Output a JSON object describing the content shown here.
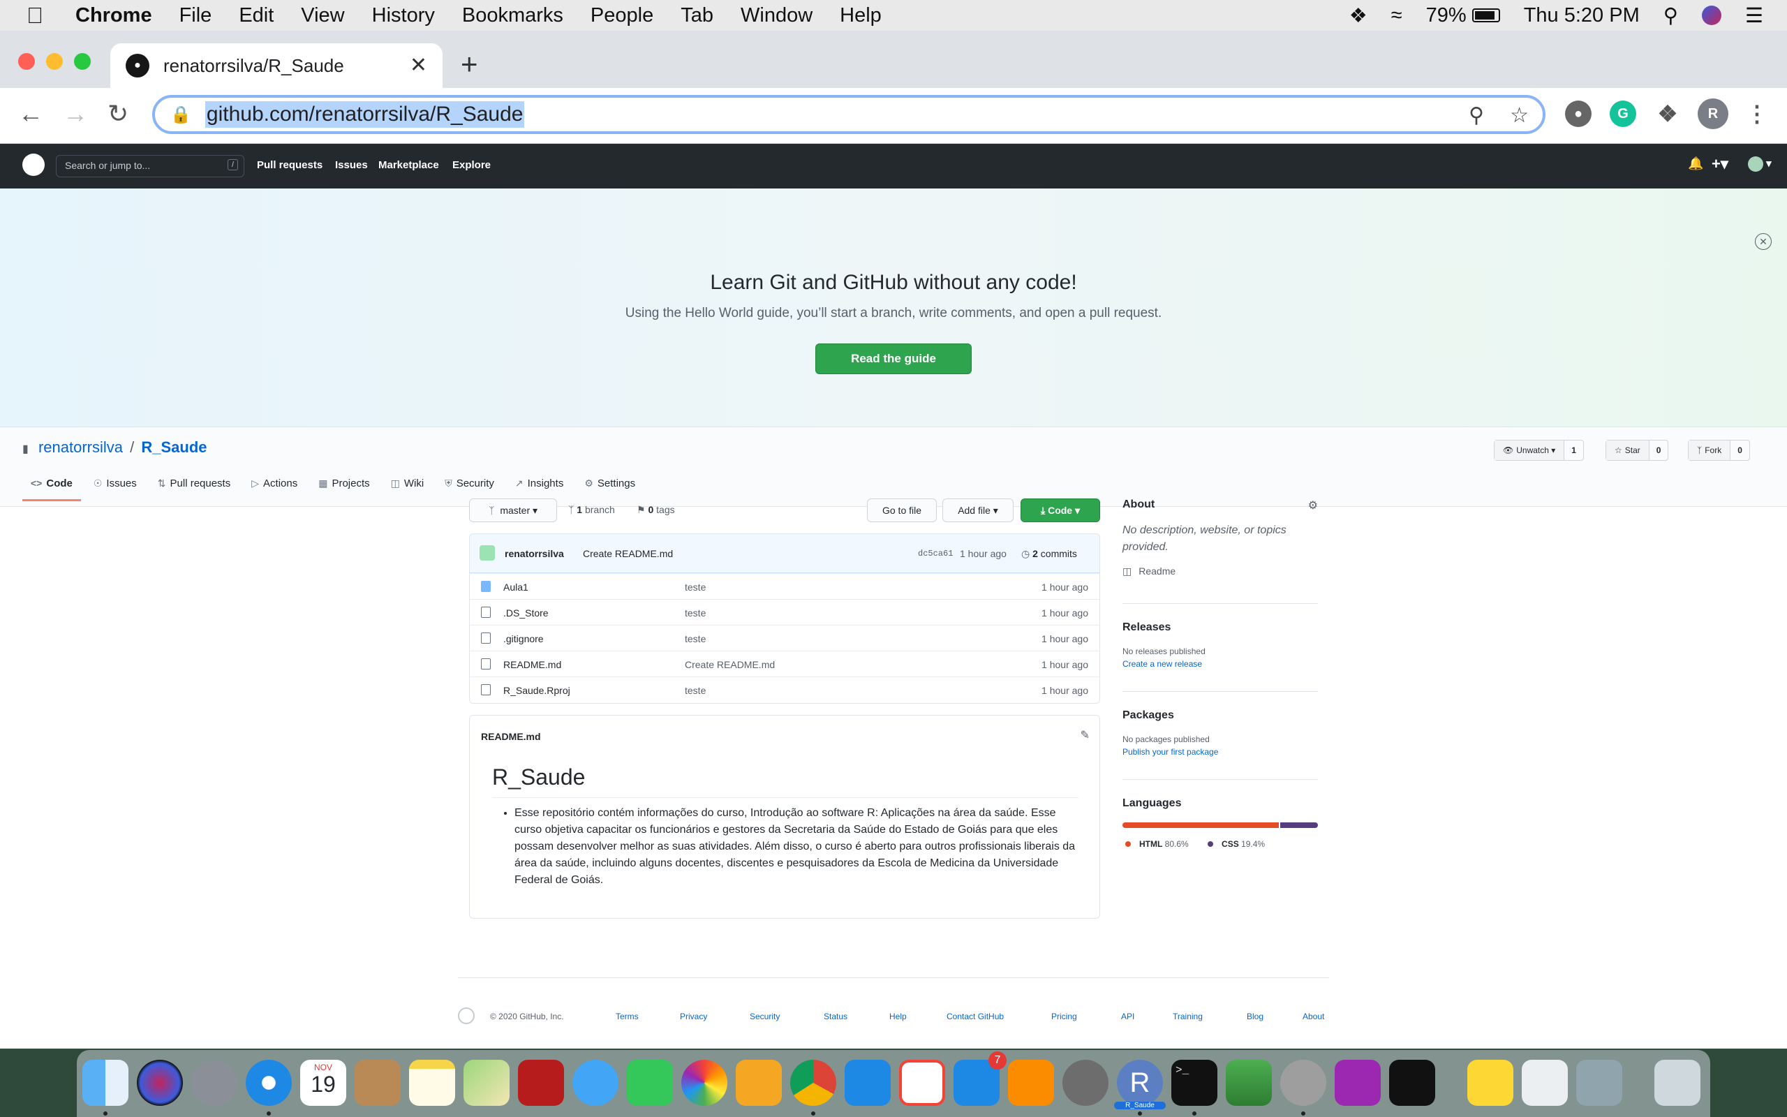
{
  "menubar": {
    "app": "Chrome",
    "items": [
      "File",
      "Edit",
      "View",
      "History",
      "Bookmarks",
      "People",
      "Tab",
      "Window",
      "Help"
    ],
    "battery": "79%",
    "clock": "Thu 5:20 PM"
  },
  "browser": {
    "tab_title": "renatorrsilva/R_Saude",
    "url": "github.com/renatorrsilva/R_Saude",
    "profile_initial": "R"
  },
  "github_header": {
    "search_placeholder": "Search or jump to...",
    "slash": "/",
    "nav": [
      "Pull requests",
      "Issues",
      "Marketplace",
      "Explore"
    ]
  },
  "banner": {
    "title": "Learn Git and GitHub without any code!",
    "subtitle": "Using the Hello World guide, you’ll start a branch, write comments, and open a pull request.",
    "button": "Read the guide"
  },
  "repo": {
    "owner": "renatorrsilva",
    "separator": "/",
    "name": "R_Saude",
    "watch_label": "Unwatch",
    "watch_count": "1",
    "star_label": "Star",
    "star_count": "0",
    "fork_label": "Fork",
    "fork_count": "0",
    "tabs": [
      "Code",
      "Issues",
      "Pull requests",
      "Actions",
      "Projects",
      "Wiki",
      "Security",
      "Insights",
      "Settings"
    ]
  },
  "filebar": {
    "branch": "master",
    "branch_count": "1",
    "branch_label": "branch",
    "tag_count": "0",
    "tag_label": "tags",
    "go_to_file": "Go to file",
    "add_file": "Add file",
    "code": "Code"
  },
  "commit": {
    "author": "renatorrsilva",
    "message": "Create README.md",
    "sha": "dc5ca61",
    "ago": "1 hour ago",
    "count": "2",
    "count_label": "commits"
  },
  "files": [
    {
      "name": "Aula1",
      "type": "dir",
      "message": "teste",
      "time": "1 hour ago"
    },
    {
      "name": ".DS_Store",
      "type": "file",
      "message": "teste",
      "time": "1 hour ago"
    },
    {
      "name": ".gitignore",
      "type": "file",
      "message": "teste",
      "time": "1 hour ago"
    },
    {
      "name": "README.md",
      "type": "file",
      "message": "Create README.md",
      "time": "1 hour ago"
    },
    {
      "name": "R_Saude.Rproj",
      "type": "file",
      "message": "teste",
      "time": "1 hour ago"
    }
  ],
  "readme": {
    "filename": "README.md",
    "heading": "R_Saude",
    "bullet": "Esse repositório contém informações do curso, Introdução ao software R: Aplicações na área da saúde. Esse curso objetiva capacitar os funcionários e gestores da Secretaria da Saúde do Estado de Goiás para que eles possam desenvolver melhor as suas atividades. Além disso, o curso é aberto para outros profissionais liberais da área da saúde, incluindo alguns docentes, discentes e pesquisadores da Escola de Medicina da Universidade Federal de Goiás."
  },
  "sidebar": {
    "about_title": "About",
    "about_text": "No description, website, or topics provided.",
    "readme_link": "Readme",
    "releases_title": "Releases",
    "releases_text": "No releases published",
    "releases_link": "Create a new release",
    "packages_title": "Packages",
    "packages_text": "No packages published",
    "packages_link": "Publish your first package",
    "languages_title": "Languages",
    "languages": [
      {
        "name": "HTML",
        "percent": "80.6%",
        "value": 80.6,
        "color": "#e34c26"
      },
      {
        "name": "CSS",
        "percent": "19.4%",
        "value": 19.4,
        "color": "#563d7c"
      }
    ]
  },
  "footer": {
    "copyright": "© 2020 GitHub, Inc.",
    "links": [
      "Terms",
      "Privacy",
      "Security",
      "Status",
      "Help",
      "Contact GitHub",
      "Pricing",
      "API",
      "Training",
      "Blog",
      "About"
    ]
  },
  "dock": {
    "calendar_month": "NOV",
    "calendar_day": "19",
    "appstore_badge": "7",
    "r_label": "R_Saude"
  }
}
